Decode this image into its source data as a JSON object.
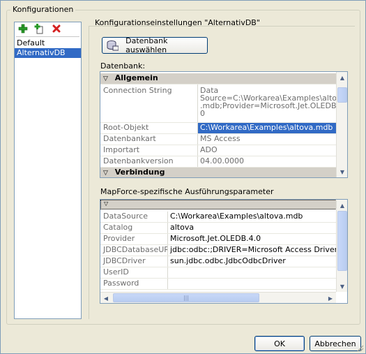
{
  "group_label": "Konfigurationen",
  "toolbar": {
    "add_icon": "add-plus-icon",
    "copy_icon": "copy-add-icon",
    "delete_icon": "delete-x-icon"
  },
  "configurations": [
    {
      "label": "Default",
      "selected": false
    },
    {
      "label": "AlternativDB",
      "selected": true
    }
  ],
  "settings_title": "Konfigurationseinstellungen \"AlternativDB\"",
  "select_db_button": "Datenbank auswählen",
  "database_label": "Datenbank:",
  "db_grid": {
    "category1": "Allgemein",
    "rows": [
      {
        "key": "Connection String",
        "value_lines": [
          "Data",
          "Source=C:\\Workarea\\Examples\\altova",
          ".mdb;Provider=Microsoft.Jet.OLEDB.4.",
          "0"
        ]
      },
      {
        "key": "Root-Objekt",
        "value": "C:\\Workarea\\Examples\\altova.mdb",
        "selected": true
      },
      {
        "key": "Datenbankart",
        "value": "MS Access"
      },
      {
        "key": "Importart",
        "value": "ADO"
      },
      {
        "key": "Datenbankversion",
        "value": "04.00.0000"
      }
    ],
    "category2": "Verbindung"
  },
  "runtime_label": "MapForce-spezifische Ausführungsparameter",
  "runtime_grid": {
    "rows": [
      {
        "key": "DataSource",
        "value": "C:\\Workarea\\Examples\\altova.mdb"
      },
      {
        "key": "Catalog",
        "value": "altova"
      },
      {
        "key": "Provider",
        "value": "Microsoft.Jet.OLEDB.4.0"
      },
      {
        "key": "JDBCDatabaseURL",
        "value": "jdbc:odbc:;DRIVER=Microsoft Access Driver (*.m"
      },
      {
        "key": "JDBCDriver",
        "value": "sun.jdbc.odbc.JdbcOdbcDriver"
      },
      {
        "key": "UserID",
        "value": ""
      },
      {
        "key": "Password",
        "value": ""
      }
    ]
  },
  "buttons": {
    "ok": "OK",
    "cancel": "Abbrechen"
  }
}
